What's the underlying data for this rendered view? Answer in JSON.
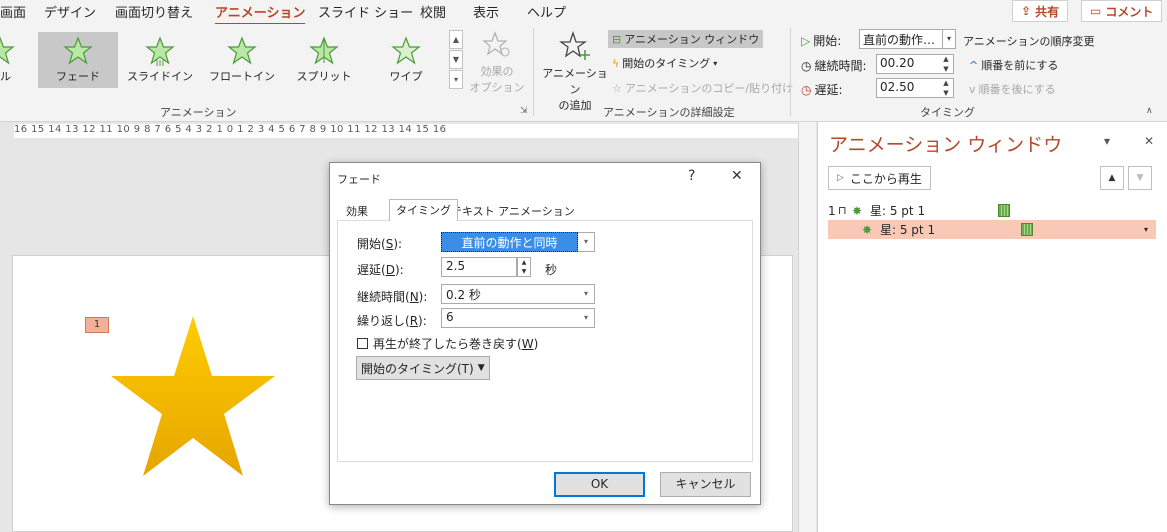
{
  "tabs": [
    "画面",
    "デザイン",
    "画面切り替え",
    "アニメーション",
    "スライド ショー",
    "校閲",
    "表示",
    "ヘルプ"
  ],
  "active_tab": "アニメーション",
  "share_label": "共有",
  "comment_label": "コメント",
  "gallery": {
    "items": [
      "ール",
      "フェード",
      "スライドイン",
      "フロートイン",
      "スプリット",
      "ワイプ"
    ],
    "selected": "フェード",
    "group_label": "アニメーション"
  },
  "effect_options": {
    "line1": "効果の",
    "line2": "オプション"
  },
  "add_animation": {
    "line1": "アニメーション",
    "line2": "の追加"
  },
  "advanced": {
    "pane_button": "アニメーション ウィンドウ",
    "trigger": "開始のタイミング",
    "painter": "アニメーションのコピー/貼り付け",
    "group_label": "アニメーションの詳細設定"
  },
  "timing": {
    "start_label": "開始:",
    "start_value": "直前の動作…",
    "duration_label": "継続時間:",
    "duration_value": "00.20",
    "delay_label": "遅延:",
    "delay_value": "02.50",
    "reorder_title": "アニメーションの順序変更",
    "move_earlier": "順番を前にする",
    "move_later": "順番を後にする",
    "group_label": "タイミング"
  },
  "ruler_text": "16 15 14 13 12 11 10 9 8 7 6 5 4 3 2 1 0 1 2 3 4 5 6 7 8 9 10 11 12 13 14 15 16",
  "slide": {
    "anim_tag": "1"
  },
  "pane": {
    "title": "アニメーション ウィンドウ",
    "play_from": "ここから再生",
    "items": [
      {
        "num": "1",
        "label": "星: 5 pt 1"
      },
      {
        "num": "",
        "label": "星: 5 pt 1"
      }
    ]
  },
  "dialog": {
    "title": "フェード",
    "help": "?",
    "close": "✕",
    "tabs": [
      "効果",
      "タイミング",
      "テキスト アニメーション"
    ],
    "active_tab": "タイミング",
    "start_label_pre": "開始(",
    "start_key": "S",
    "start_label_post": "):",
    "start_value": "直前の動作と同時",
    "delay_label_pre": "遅延(",
    "delay_key": "D",
    "delay_label_post": "):",
    "delay_value": "2.5",
    "delay_unit": "秒",
    "duration_label_pre": "継続時間(",
    "duration_key": "N",
    "duration_label_post": "):",
    "duration_value": "0.2 秒",
    "repeat_label_pre": "繰り返し(",
    "repeat_key": "R",
    "repeat_label_post": "):",
    "repeat_value": "6",
    "rewind_pre": "再生が終了したら巻き戻す(",
    "rewind_key": "W",
    "rewind_post": ")",
    "triggers_label": "開始のタイミング(T)",
    "ok": "OK",
    "cancel": "キャンセル"
  },
  "colors": {
    "accent": "#b7472a",
    "star": "#f5b400",
    "selection": "#3a8ee8"
  }
}
